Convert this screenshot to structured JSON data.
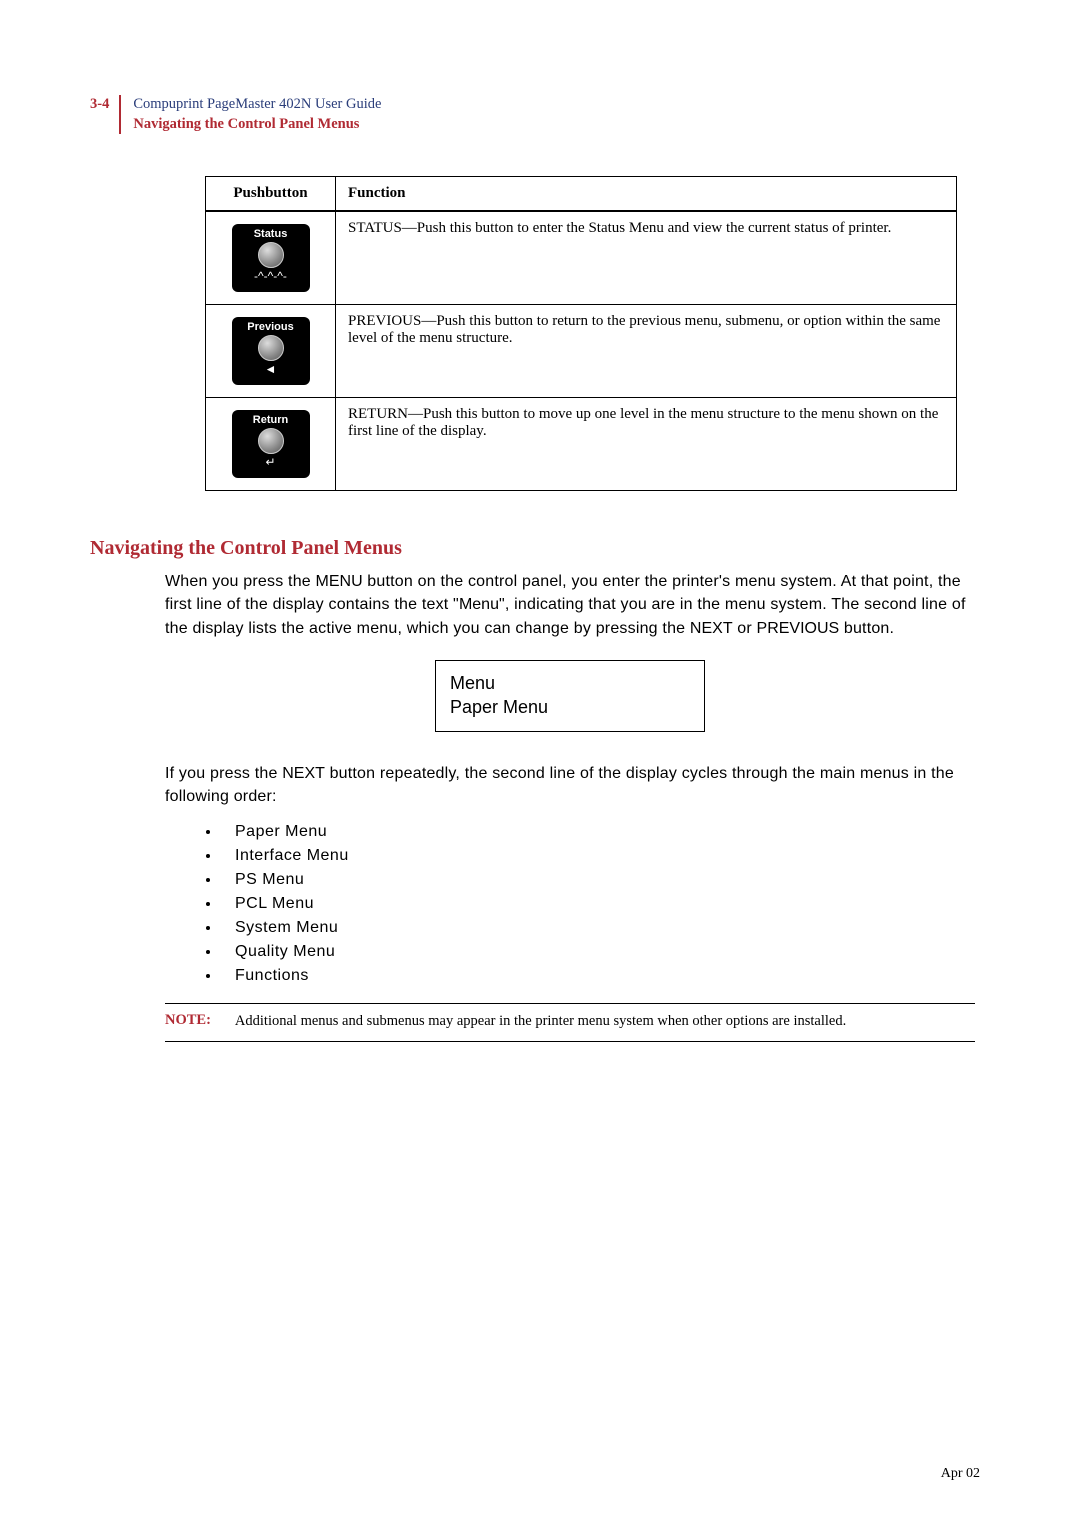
{
  "header": {
    "page_number": "3-4",
    "title": "Compuprint PageMaster 402N User Guide",
    "subtitle": "Navigating the Control Panel Menus"
  },
  "table": {
    "headers": [
      "Pushbutton",
      "Function"
    ],
    "rows": [
      {
        "button_label": "Status",
        "button_sub": "-^-^-^-",
        "function": "STATUS—Push this button to enter the Status Menu and view the current status of printer."
      },
      {
        "button_label": "Previous",
        "button_sub": "◄",
        "function": "PREVIOUS—Push this button to return to the previous menu, submenu, or option within the same level of the menu structure."
      },
      {
        "button_label": "Return",
        "button_sub": "↵",
        "function": "RETURN—Push this button to move up one level in the menu structure to the menu shown on the first line of the display."
      }
    ]
  },
  "section": {
    "title": "Navigating the Control Panel Menus",
    "para1_a": "When you press the ",
    "para1_b": "MENU",
    "para1_c": " button on the control panel, you enter the printer's menu system. At that point, the first line of the display contains the text \"",
    "para1_d": "Menu",
    "para1_e": "\", indicating that you are in the menu system. The second line of the display lists the active menu, which you can change by pressing the ",
    "para1_f": "NEXT",
    "para1_g": " or ",
    "para1_h": "PREVIOUS",
    "para1_i": " button.",
    "display_line1": "Menu",
    "display_line2": "Paper Menu",
    "para2_a": "If you press the ",
    "para2_b": "NEXT",
    "para2_c": " button repeatedly, the second line of the display cycles through the main menus in the following order:",
    "menu_items": [
      "Paper Menu",
      "Interface Menu",
      "PS Menu",
      "PCL Menu",
      "System Menu",
      "Quality Menu",
      "Functions"
    ],
    "note_label": "NOTE:",
    "note_text": "Additional menus and submenus may appear in the printer menu system when other options are installed."
  },
  "footer": "Apr 02"
}
